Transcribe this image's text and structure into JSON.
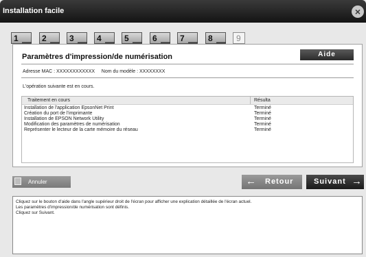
{
  "window": {
    "title": "Installation facile"
  },
  "steps": [
    {
      "number": "1"
    },
    {
      "number": "2"
    },
    {
      "number": "3"
    },
    {
      "number": "4"
    },
    {
      "number": "5"
    },
    {
      "number": "6"
    },
    {
      "number": "7"
    },
    {
      "number": "8"
    },
    {
      "number": "9"
    }
  ],
  "panel": {
    "heading": "Paramètres d'impression/de numérisation",
    "help_label": "Aide",
    "info_line": "Adresse MAC : XXXXXXXXXXXX     Nom du modèle : XXXXXXXX",
    "status_message": "L'opération suivante est en cours."
  },
  "table": {
    "headers": [
      "Traitement en cours",
      "Résulta"
    ],
    "rows": [
      {
        "task": "Installation de l'application EpsonNet Print",
        "result": "Terminé"
      },
      {
        "task": "Création du port de l'imprimante",
        "result": "Terminé"
      },
      {
        "task": "Installation de EPSON Network Utility",
        "result": "Terminé"
      },
      {
        "task": "Modification des paramètres de numérisation",
        "result": "Terminé"
      },
      {
        "task": "Représenter le lecteur de la carte mémoire du réseau",
        "result": "Terminé"
      }
    ]
  },
  "buttons": {
    "cancel": "Annuler",
    "back": "Retour",
    "next": "Suivant"
  },
  "description": [
    "Cliquez sur le bouton d'aide dans l'angle supérieur droit de l'écran pour afficher une explication détaillée de l'écran actuel.",
    "Les paramètres d'impression/de numérisation sont définis.",
    "Cliquez sur Suivant."
  ],
  "colors": {
    "titlebar": "#1e1e1e",
    "accent_button": "#2a2a2a",
    "disabled_button": "#8a8a8a"
  }
}
